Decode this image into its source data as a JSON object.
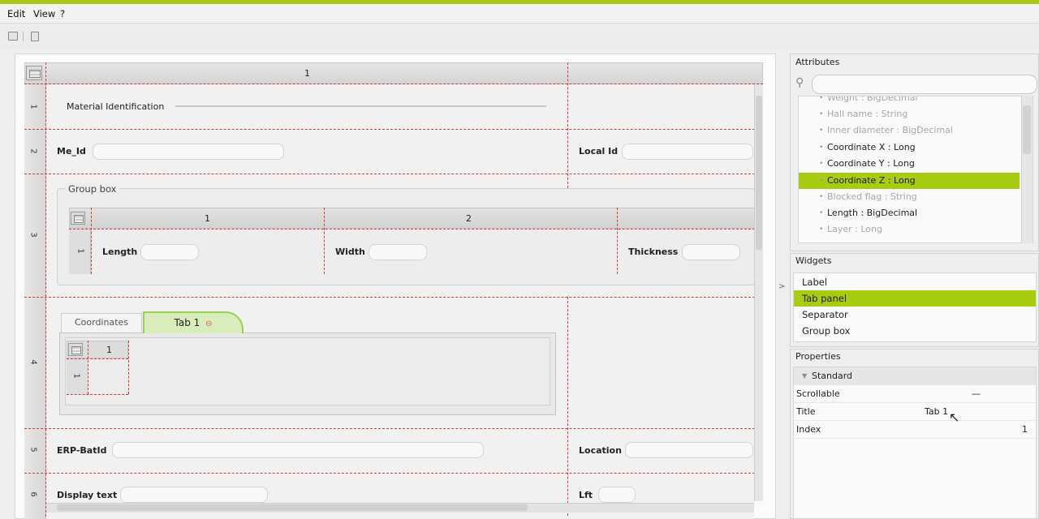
{
  "menu": {
    "edit": "Edit",
    "view": "View",
    "help": "?"
  },
  "grid": {
    "col_headers": [
      "1"
    ],
    "row_headers": [
      "1",
      "2",
      "3",
      "4",
      "5",
      "6"
    ]
  },
  "form": {
    "row1_label": "Material Identification",
    "me_id_label": "Me_Id",
    "local_id_label": "Local Id",
    "group_box_title": "Group box",
    "group_col_headers": [
      "1",
      "2"
    ],
    "group_row_header": "1",
    "length_label": "Length",
    "width_label": "Width",
    "thickness_label": "Thickness",
    "tab_coordinates": "Coordinates",
    "tab_active": "Tab 1",
    "tab_col_header": "1",
    "tab_row_header": "1",
    "erp_label": "ERP-BatId",
    "location_label": "Location",
    "display_text_label": "Display text",
    "lft_label": "Lft"
  },
  "attributes": {
    "title": "Attributes",
    "search_placeholder": "",
    "items": [
      {
        "label": "Weight : BigDecimal",
        "style": "dim"
      },
      {
        "label": "Hall name : String",
        "style": "dim"
      },
      {
        "label": "Inner diameter : BigDecimal",
        "style": "dim"
      },
      {
        "label": "Coordinate X : Long",
        "style": "normal"
      },
      {
        "label": "Coordinate Y : Long",
        "style": "normal"
      },
      {
        "label": "Coordinate Z : Long",
        "style": "selected"
      },
      {
        "label": "Blocked flag : String",
        "style": "dim"
      },
      {
        "label": "Length : BigDecimal",
        "style": "normal"
      },
      {
        "label": "Layer : Long",
        "style": "dim"
      }
    ]
  },
  "widgets": {
    "title": "Widgets",
    "items": [
      {
        "label": "Label",
        "selected": false
      },
      {
        "label": "Tab panel",
        "selected": true
      },
      {
        "label": "Separator",
        "selected": false
      },
      {
        "label": "Group box",
        "selected": false
      }
    ]
  },
  "properties": {
    "title": "Properties",
    "section": "Standard",
    "rows": [
      {
        "name": "Scrollable",
        "value": "—"
      },
      {
        "name": "Title",
        "value": "Tab 1"
      },
      {
        "name": "Index",
        "value": "1"
      }
    ]
  },
  "colors": {
    "accent": "#a8cc10",
    "guide": "#d8383a"
  }
}
